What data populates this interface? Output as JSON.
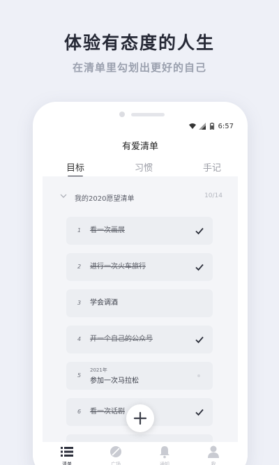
{
  "promo": {
    "headline": "体验有态度的人生",
    "subline": "在清单里勾划出更好的自己"
  },
  "status_bar": {
    "time": "6:57",
    "icons": [
      "wifi-icon",
      "signal-icon",
      "battery-icon"
    ]
  },
  "app": {
    "title": "有爱清单"
  },
  "tabs": [
    {
      "label": "目标",
      "active": true
    },
    {
      "label": "习惯",
      "active": false
    },
    {
      "label": "手记",
      "active": false
    }
  ],
  "group": {
    "title": "我的2020愿望清单",
    "count": "10/14"
  },
  "items": [
    {
      "num": "1",
      "label": "看一次画展",
      "done": true
    },
    {
      "num": "2",
      "label": "进行一次火车旅行",
      "done": true
    },
    {
      "num": "3",
      "label": "学会调酒",
      "done": false
    },
    {
      "num": "4",
      "label": "开一个自己的公众号",
      "done": true
    },
    {
      "num": "5",
      "year": "2021年",
      "label": "参加一次马拉松",
      "done": false
    },
    {
      "num": "6",
      "label": "看一次话剧",
      "done": true
    }
  ],
  "fab": {
    "icon": "plus-icon"
  },
  "bottom_nav": [
    {
      "label": "清单",
      "icon": "list-icon",
      "active": true
    },
    {
      "label": "广场",
      "icon": "compass-icon",
      "active": false
    },
    {
      "label": "通知",
      "icon": "bell-icon",
      "active": false
    },
    {
      "label": "我",
      "icon": "user-icon",
      "active": false
    }
  ],
  "colors": {
    "background": "#eef0f7",
    "accent": "#2b2e3a",
    "muted": "#9aa0ae"
  }
}
